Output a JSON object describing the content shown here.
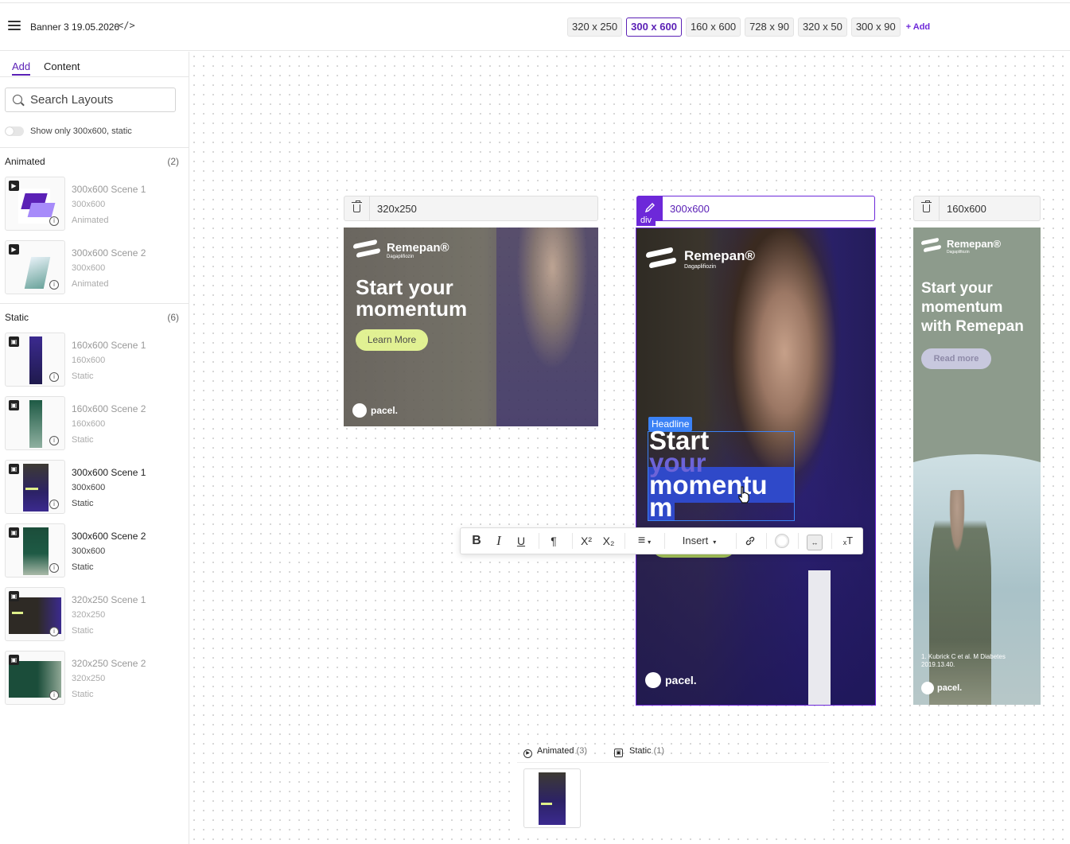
{
  "topbar": {
    "doc_title": "Banner 3 19.05.2026",
    "code_icon": "</>",
    "sizes": [
      "320 x 250",
      "300 x 600",
      "160 x 600",
      "728 x 90",
      "320 x 50",
      "300 x 90"
    ],
    "active_size": "300 x 600",
    "add_label": "+ Add"
  },
  "sidebar": {
    "tabs": [
      "Add",
      "Content"
    ],
    "active_tab": "Add",
    "search_placeholder": "Search Layouts",
    "toggle_label": "Show only 300x600, static",
    "animated": {
      "title": "Animated",
      "count": "(2)",
      "items": [
        {
          "name": "300x600 Scene 1",
          "dims": "300x600",
          "kind": "Animated"
        },
        {
          "name": "300x600 Scene 2",
          "dims": "300x600",
          "kind": "Animated"
        }
      ]
    },
    "static": {
      "title": "Static",
      "count": "(6)",
      "items": [
        {
          "name": "160x600 Scene 1",
          "dims": "160x600",
          "kind": "Static"
        },
        {
          "name": "160x600 Scene 2",
          "dims": "160x600",
          "kind": "Static"
        },
        {
          "name": "300x600 Scene 1",
          "dims": "300x600",
          "kind": "Static"
        },
        {
          "name": "300x600 Scene 2",
          "dims": "300x600",
          "kind": "Static"
        },
        {
          "name": "320x250 Scene 1",
          "dims": "320x250",
          "kind": "Static"
        },
        {
          "name": "320x250 Scene 2",
          "dims": "320x250",
          "kind": "Static"
        }
      ]
    }
  },
  "frames": {
    "f320": {
      "label": "320x250"
    },
    "f300": {
      "label": "300x600",
      "tag": "div"
    },
    "f160": {
      "label": "160x600"
    }
  },
  "banners": {
    "b320": {
      "brand": "Remepan®",
      "sub": "Dagaplifiozin",
      "headline_1": "Start your",
      "headline_2": "momentum",
      "cta": "Learn More",
      "footer": "pacel."
    },
    "b300": {
      "brand": "Remepan®",
      "sub": "Dagaplifiozin",
      "badge": "Headline",
      "h1": "Start",
      "h2": "your",
      "h3": "momentu",
      "h4": "m",
      "footer": "pacel."
    },
    "b160": {
      "brand": "Remepan®",
      "sub": "Dagaplifiozin",
      "headline": "Start your momentum with Remepan",
      "cta": "Read more",
      "ref": "1. Kubrick C et al. M Diabetes 2019.13.40.",
      "footer": "pacel."
    }
  },
  "toolbar": {
    "bold": "B",
    "italic": "I",
    "underline": "U",
    "paragraph": "¶",
    "superscript": "X²",
    "subscript": "X₂",
    "align": "≡",
    "insert": "Insert"
  },
  "tray": {
    "animated_label": "Animated",
    "animated_count": "(3)",
    "static_label": "Static",
    "static_count": "(1)"
  },
  "colors": {
    "accent": "#5b21b6",
    "brand_purple": "#3b2a8f",
    "cta_lime": "#dff08a"
  }
}
